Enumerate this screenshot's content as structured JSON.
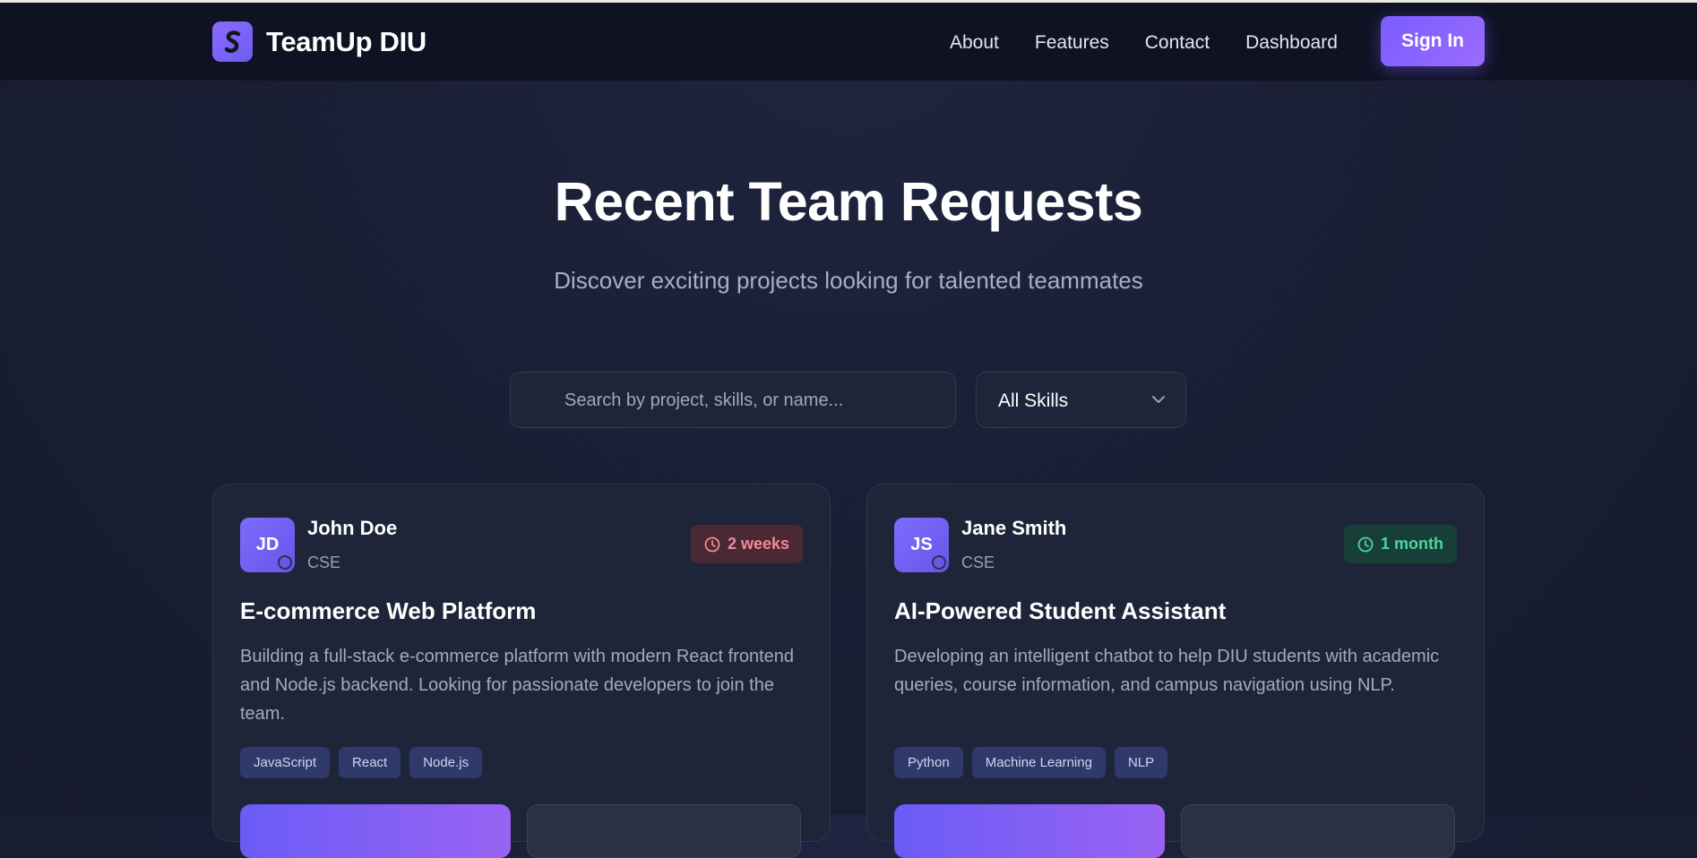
{
  "nav": {
    "brand": "TeamUp DIU",
    "logo_icon": "s-logo-icon",
    "links": [
      "About",
      "Features",
      "Contact",
      "Dashboard"
    ],
    "signin": "Sign In"
  },
  "hero": {
    "title": "Recent Team Requests",
    "subtitle": "Discover exciting projects looking for talented teammates"
  },
  "filters": {
    "search_placeholder": "Search by project, skills, or name...",
    "skill_selected": "All Skills"
  },
  "cards": [
    {
      "initials": "JD",
      "name": "John Doe",
      "dept": "CSE",
      "duration": "2 weeks",
      "duration_color": "#f08a96",
      "title": "E-commerce Web Platform",
      "description": "Building a full-stack e-commerce platform with modern React frontend and Node.js backend. Looking for passionate developers to join the team.",
      "tags": [
        "JavaScript",
        "React",
        "Node.js"
      ]
    },
    {
      "initials": "JS",
      "name": "Jane Smith",
      "dept": "CSE",
      "duration": "1 month",
      "duration_color": "#4dd59c",
      "title": "AI-Powered Student Assistant",
      "description": "Developing an intelligent chatbot to help DIU students with academic queries, course information, and campus navigation using NLP.",
      "tags": [
        "Python",
        "Machine Learning",
        "NLP"
      ]
    }
  ],
  "colors": {
    "accent": "#7b5cff",
    "background": "#1a1f35",
    "card": "#1e2539"
  }
}
